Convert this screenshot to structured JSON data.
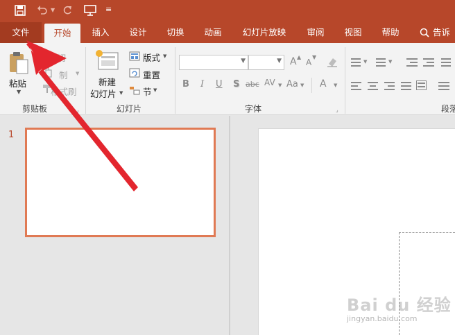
{
  "colors": {
    "accent": "#b7472a",
    "arrow": "#e3262e"
  },
  "tabs": [
    "文件",
    "开始",
    "插入",
    "设计",
    "切换",
    "动画",
    "幻灯片放映",
    "审阅",
    "视图",
    "帮助"
  ],
  "tell_me": "告诉",
  "clipboard": {
    "paste": "粘贴",
    "cut": "剪切",
    "copy": "制",
    "format": "格式刷",
    "label": "剪贴板"
  },
  "slides": {
    "new_line1": "新建",
    "new_line2": "幻灯片",
    "layout": "版式",
    "reset": "重置",
    "section": "节",
    "label": "幻灯片"
  },
  "font": {
    "label": "字体",
    "bold": "B",
    "italic": "I",
    "underline": "U",
    "shadow": "S",
    "strike": "abc",
    "spacing": "AV",
    "case": "Aa",
    "color": "A",
    "grow": "A",
    "shrink": "A"
  },
  "paragraph": {
    "label": "段落"
  },
  "thumbnail": {
    "number": "1"
  },
  "watermark": {
    "main": "Bai du 经验",
    "sub": "jingyan.baidu.com"
  }
}
